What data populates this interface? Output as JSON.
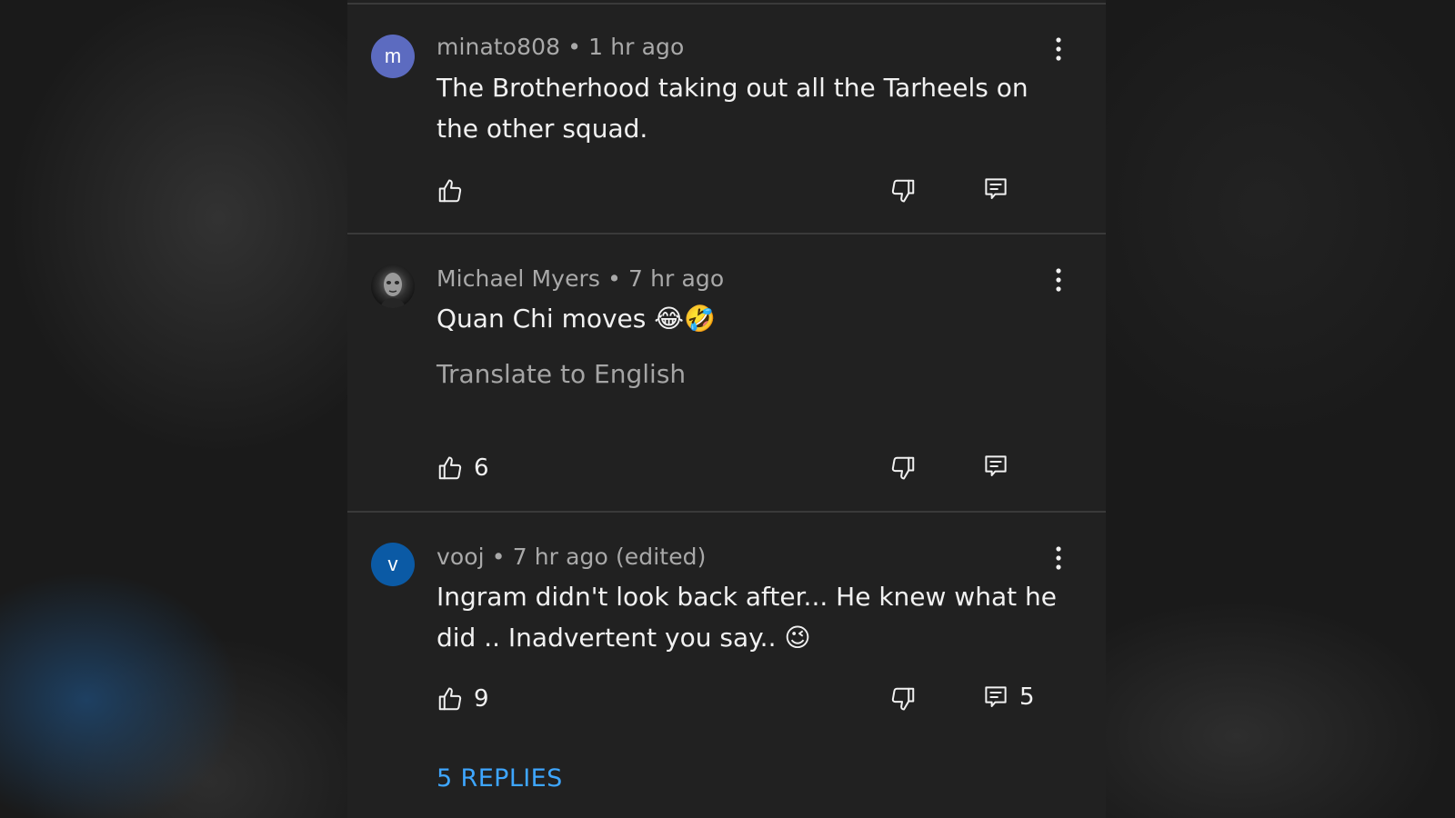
{
  "colors": {
    "panel_background": "#212121",
    "outer_background": "#1a1a1a",
    "divider": "#3a3a3a",
    "primary_text": "#f1f1f1",
    "secondary_text": "#a9a9a9",
    "link_blue": "#3ea6ff"
  },
  "comments": [
    {
      "author": "minato808",
      "separator": "•",
      "time": "1 hr ago",
      "text": "The Brotherhood taking out all the Tarheels on the other squad.",
      "avatar": {
        "type": "letter",
        "letter": "m",
        "color": "#5c6bc0"
      },
      "like_count": "",
      "reply_count": "",
      "more_icon": "more-vert-icon",
      "like_icon": "thumbs-up-icon",
      "dislike_icon": "thumbs-down-icon",
      "reply_icon": "comment-icon"
    },
    {
      "author": "Michael Myers",
      "separator": "•",
      "time": "7 hr ago",
      "text": "Quan Chi moves 😂🤣",
      "translate_label": "Translate to English",
      "avatar": {
        "type": "photo"
      },
      "like_count": "6",
      "reply_count": "",
      "more_icon": "more-vert-icon",
      "like_icon": "thumbs-up-icon",
      "dislike_icon": "thumbs-down-icon",
      "reply_icon": "comment-icon"
    },
    {
      "author": "vooj",
      "separator": "•",
      "time": "7 hr ago (edited)",
      "text": "Ingram didn't look back after... He knew what he did ..  Inadvertent you say.. 😉",
      "avatar": {
        "type": "letter",
        "letter": "v",
        "color": "#0b5aa5"
      },
      "like_count": "9",
      "reply_count": "5",
      "replies_label": "5 REPLIES",
      "more_icon": "more-vert-icon",
      "like_icon": "thumbs-up-icon",
      "dislike_icon": "thumbs-down-icon",
      "reply_icon": "comment-icon"
    }
  ]
}
